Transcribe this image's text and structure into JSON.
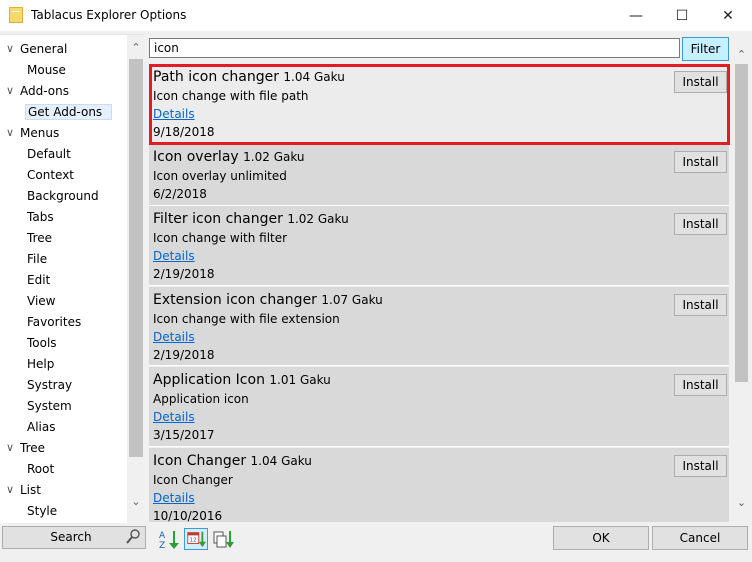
{
  "window": {
    "title": "Tablacus Explorer Options",
    "min_glyph": "—",
    "max_glyph": "☐",
    "close_glyph": "✕"
  },
  "tree": {
    "items": [
      {
        "label": "General",
        "expander": "∨"
      },
      {
        "label": "Mouse"
      },
      {
        "label": "Add-ons",
        "expander": "∨"
      },
      {
        "label": "Get Add-ons",
        "selected": true
      },
      {
        "label": "Menus",
        "expander": "∨"
      },
      {
        "label": "Default"
      },
      {
        "label": "Context"
      },
      {
        "label": "Background"
      },
      {
        "label": "Tabs"
      },
      {
        "label": "Tree"
      },
      {
        "label": "File"
      },
      {
        "label": "Edit"
      },
      {
        "label": "View"
      },
      {
        "label": "Favorites"
      },
      {
        "label": "Tools"
      },
      {
        "label": "Help"
      },
      {
        "label": "Systray"
      },
      {
        "label": "System"
      },
      {
        "label": "Alias"
      },
      {
        "label": "Tree",
        "expander": "∨"
      },
      {
        "label": "Root"
      },
      {
        "label": "List",
        "expander": "∨"
      },
      {
        "label": "Style"
      }
    ],
    "search_label": "Search"
  },
  "filter": {
    "value": "icon",
    "button_label": "Filter"
  },
  "addons": [
    {
      "name": "Path icon changer",
      "version": "1.04 Gaku",
      "description": "Icon change with file path",
      "details": "Details",
      "date": "9/18/2018",
      "install": "Install"
    },
    {
      "name": "Icon overlay",
      "version": "1.02 Gaku",
      "description": "Icon overlay unlimited",
      "details": "",
      "date": "6/2/2018",
      "install": "Install"
    },
    {
      "name": "Filter icon changer",
      "version": "1.02 Gaku",
      "description": "Icon change with filter",
      "details": "Details",
      "date": "2/19/2018",
      "install": "Install"
    },
    {
      "name": "Extension icon changer",
      "version": "1.07 Gaku",
      "description": "Icon change with file extension",
      "details": "Details",
      "date": "2/19/2018",
      "install": "Install"
    },
    {
      "name": "Application Icon",
      "version": "1.01 Gaku",
      "description": "Application icon",
      "details": "Details",
      "date": "3/15/2017",
      "install": "Install"
    },
    {
      "name": "Icon Changer",
      "version": "1.04 Gaku",
      "description": "Icon Changer",
      "details": "Details",
      "date": "10/10/2016",
      "install": "Install"
    }
  ],
  "footer": {
    "ok_label": "OK",
    "cancel_label": "Cancel"
  },
  "colors": {
    "highlight_border": "#e11c24",
    "link": "#0066cc",
    "filter_button": "#c4f0ff"
  }
}
